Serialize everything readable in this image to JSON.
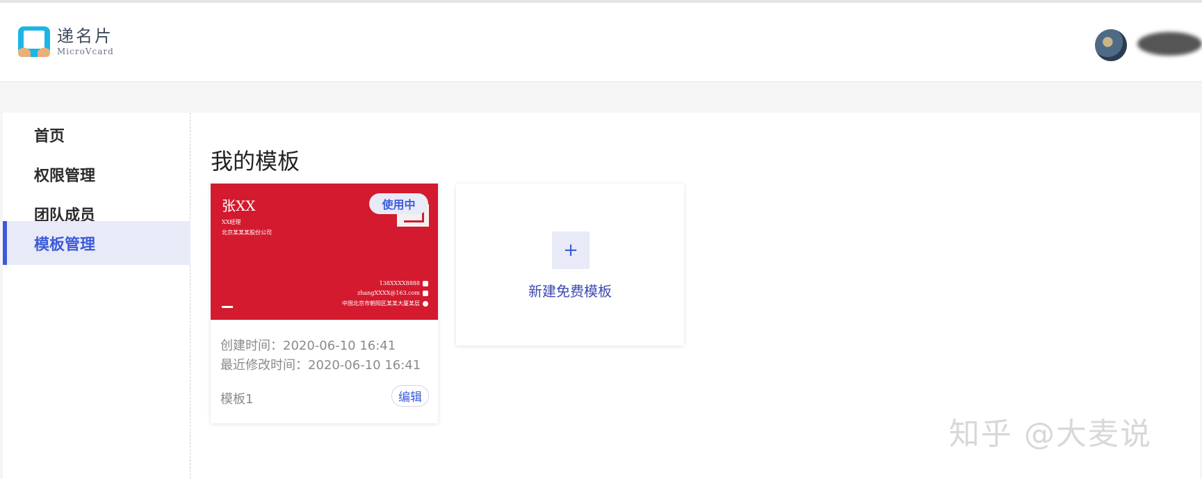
{
  "app": {
    "logo_cn": "递名片",
    "logo_en": "MicroVcard"
  },
  "sidebar": {
    "items": [
      {
        "label": "首页"
      },
      {
        "label": "权限管理"
      },
      {
        "label": "团队成员"
      },
      {
        "label": "模板管理",
        "active": true
      }
    ]
  },
  "main": {
    "title": "我的模板",
    "template_card": {
      "preview": {
        "name": "张XX",
        "job_title": "XX经理",
        "company": "北京某某某股份公司",
        "phone": "138XXXX8888",
        "email": "zhangXXXX@163.com",
        "address": "中国北京市朝阳区某某大厦某层",
        "badge": "使用中"
      },
      "created": "创建时间：2020-06-10 16:41",
      "modified": "最近修改时间：2020-06-10 16:41",
      "name": "模板1",
      "edit_label": "编辑"
    },
    "new_template": {
      "plus": "+",
      "label": "新建免费模板"
    }
  },
  "watermark": "知乎 @大麦说",
  "colors": {
    "accent": "#3d5bd9",
    "card_red": "#d31a2e",
    "active_bg": "#e8eaf8"
  }
}
